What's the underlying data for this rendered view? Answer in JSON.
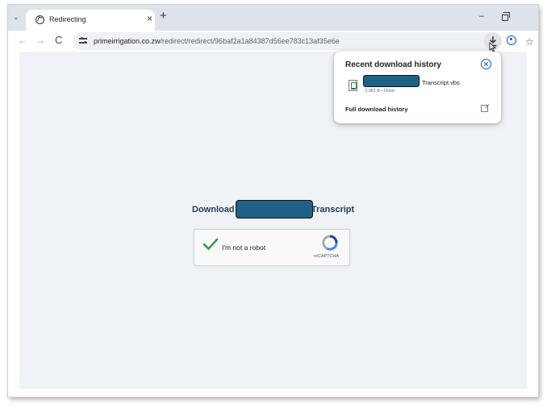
{
  "tab": {
    "title": "Redirecting",
    "close": "×",
    "new_tab": "+"
  },
  "window": {
    "minimize": "–"
  },
  "toolbar": {
    "back": "←",
    "forward": "→",
    "reload": "C",
    "url_domain": "primeirrigation.co.zw",
    "url_path": "/redirect/redirect/96baf2a1a84387d56ee783c13af35e6e",
    "bookmark": "☆"
  },
  "page": {
    "heading_prefix": "Download",
    "heading_suffix": "Transcript",
    "captcha": {
      "label": "I'm not a robot",
      "brand": "reCAPTCHA"
    }
  },
  "download_bubble": {
    "title": "Recent download history",
    "file_name": "Transcript.vbs",
    "file_meta": "2,081 B • Done",
    "full_history": "Full download history"
  },
  "colors": {
    "redaction": "#1f6288",
    "accent": "#0b57d0",
    "page_bg": "#eff3f7",
    "heading": "#1f3a55"
  }
}
